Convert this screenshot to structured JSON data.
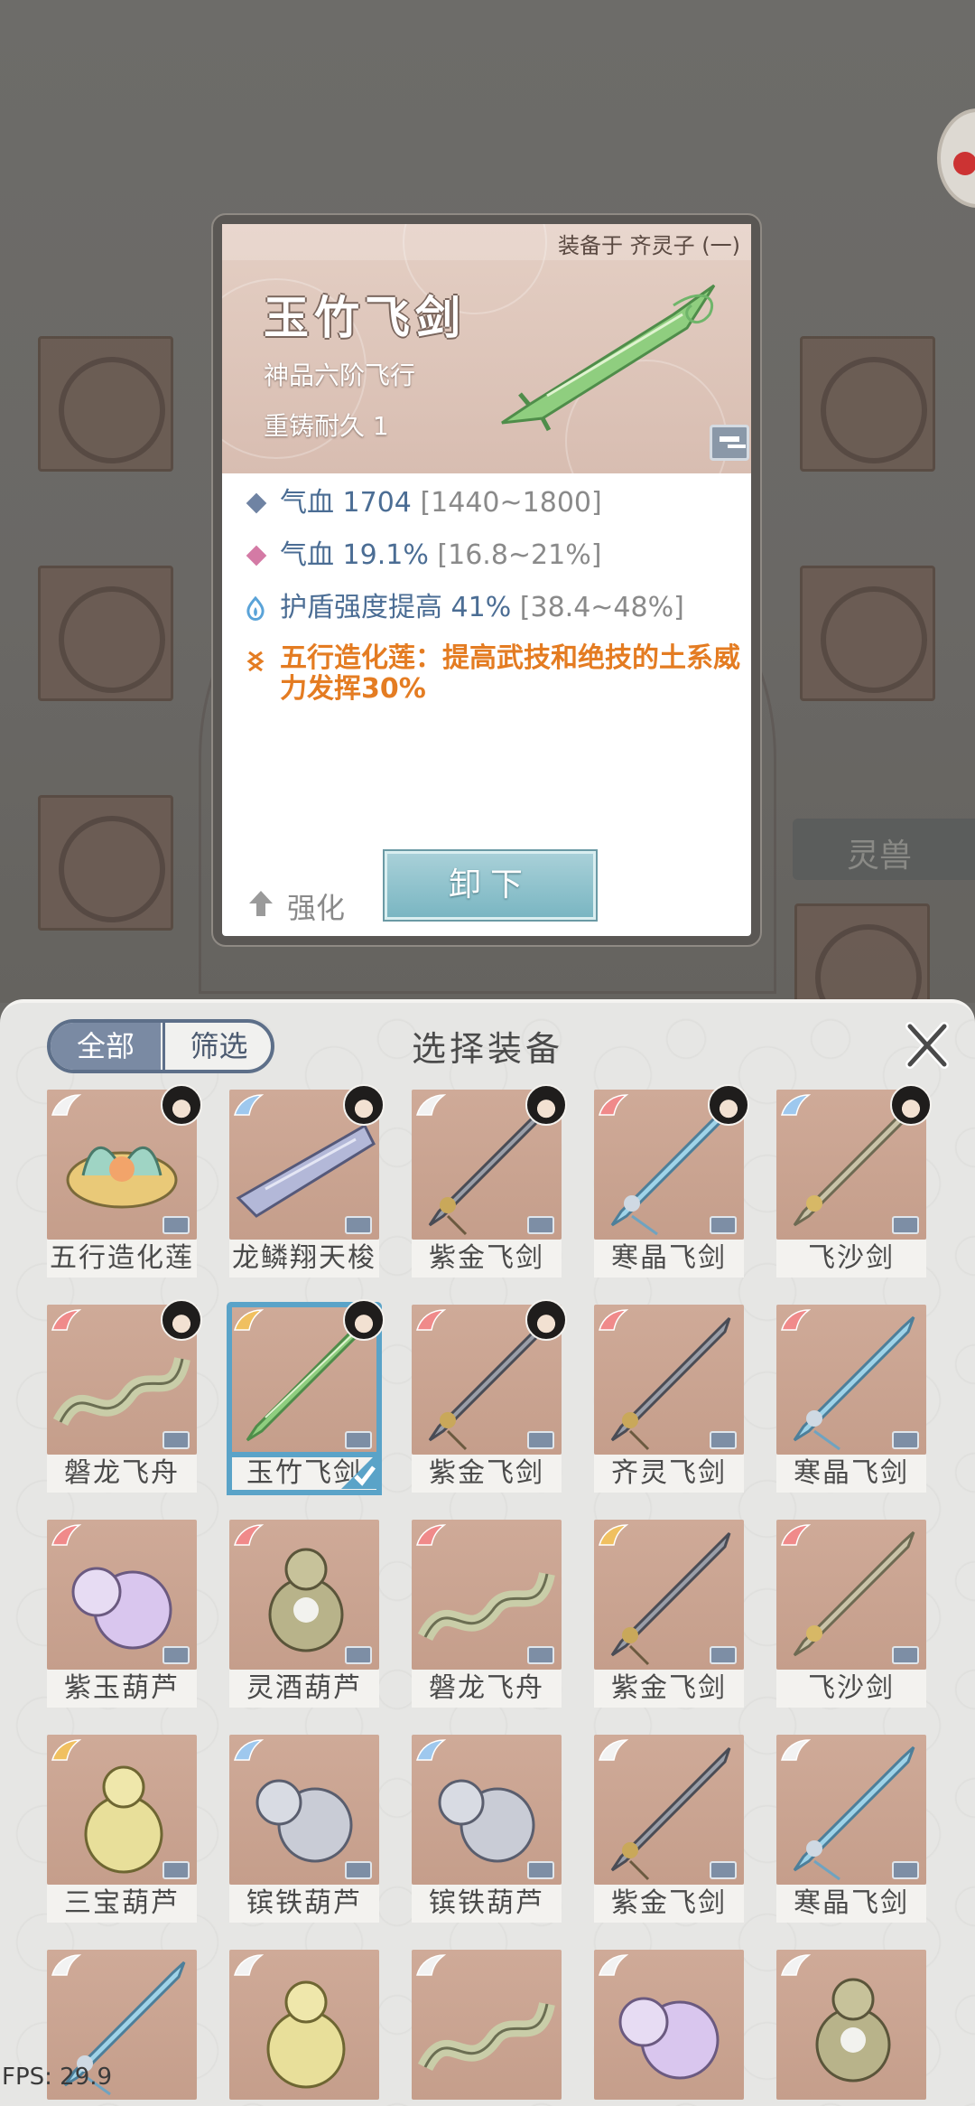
{
  "background": {
    "beast_tab_label": "灵兽"
  },
  "detail_card": {
    "equipped_on": "装备于 齐灵子 (一)",
    "title": "玉竹飞剑",
    "grade": "神品六阶飞行",
    "recast_durability": "重铸耐久 1",
    "stats": [
      {
        "icon": "blue-diamond-icon",
        "name": "气血",
        "value": "1704",
        "range": "[1440~1800]"
      },
      {
        "icon": "pink-diamond-icon",
        "name": "气血",
        "value": "19.1%",
        "range": "[16.8~21%]"
      },
      {
        "icon": "shield-flame-icon",
        "name": "护盾强度提高",
        "value": "41%",
        "range": "[38.4~48%]"
      }
    ],
    "special_effect": "五行造化莲：提高武技和绝技的土系威力发挥30%",
    "enhance_label": "强化",
    "unequip_label": "卸下"
  },
  "panel": {
    "tab_all": "全部",
    "tab_filter": "筛选",
    "title": "选择装备",
    "close_label": "X"
  },
  "items": [
    {
      "name": "五行造化莲",
      "wing": "#f2f2f2",
      "has_avatar": true,
      "kind": "lotus"
    },
    {
      "name": "龙鳞翔天梭",
      "wing": "#9ec8ee",
      "has_avatar": true,
      "kind": "boat"
    },
    {
      "name": "紫金飞剑",
      "wing": "#f2f2f2",
      "has_avatar": true,
      "kind": "sword-dark"
    },
    {
      "name": "寒晶飞剑",
      "wing": "#f08a8a",
      "has_avatar": true,
      "kind": "sword-ice"
    },
    {
      "name": "飞沙剑",
      "wing": "#9ec8ee",
      "has_avatar": true,
      "kind": "sword-gold"
    },
    {
      "name": "磐龙飞舟",
      "wing": "#f08a8a",
      "has_avatar": true,
      "kind": "dragon"
    },
    {
      "name": "玉竹飞剑",
      "wing": "#f0c060",
      "has_avatar": true,
      "kind": "sword-jade",
      "selected": true
    },
    {
      "name": "紫金飞剑",
      "wing": "#f08a8a",
      "has_avatar": true,
      "kind": "sword-dark"
    },
    {
      "name": "齐灵飞剑",
      "wing": "#f08a8a",
      "has_avatar": false,
      "kind": "sword-dark"
    },
    {
      "name": "寒晶飞剑",
      "wing": "#f08a8a",
      "has_avatar": false,
      "kind": "sword-ice"
    },
    {
      "name": "紫玉葫芦",
      "wing": "#f08a8a",
      "has_avatar": false,
      "kind": "gourd-purple"
    },
    {
      "name": "灵酒葫芦",
      "wing": "#f08a8a",
      "has_avatar": false,
      "kind": "gourd-green"
    },
    {
      "name": "磐龙飞舟",
      "wing": "#f08a8a",
      "has_avatar": false,
      "kind": "dragon"
    },
    {
      "name": "紫金飞剑",
      "wing": "#f0c060",
      "has_avatar": false,
      "kind": "sword-dark"
    },
    {
      "name": "飞沙剑",
      "wing": "#f08a8a",
      "has_avatar": false,
      "kind": "sword-gold"
    },
    {
      "name": "三宝葫芦",
      "wing": "#f0c060",
      "has_avatar": false,
      "kind": "gourd-gold"
    },
    {
      "name": "镔铁葫芦",
      "wing": "#9ec8ee",
      "has_avatar": false,
      "kind": "gourd-iron"
    },
    {
      "name": "镔铁葫芦",
      "wing": "#9ec8ee",
      "has_avatar": false,
      "kind": "gourd-iron"
    },
    {
      "name": "紫金飞剑",
      "wing": "#f2f2f2",
      "has_avatar": false,
      "kind": "sword-dark"
    },
    {
      "name": "寒晶飞剑",
      "wing": "#f2f2f2",
      "has_avatar": false,
      "kind": "sword-ice"
    },
    {
      "name": "",
      "wing": "#f2f2f2",
      "has_avatar": false,
      "kind": "sword-ice",
      "partial": true
    },
    {
      "name": "",
      "wing": "#f2f2f2",
      "has_avatar": false,
      "kind": "gourd-gold",
      "partial": true
    },
    {
      "name": "",
      "wing": "#f2f2f2",
      "has_avatar": false,
      "kind": "dragon",
      "partial": true
    },
    {
      "name": "",
      "wing": "#f2f2f2",
      "has_avatar": false,
      "kind": "gourd-purple",
      "partial": true
    },
    {
      "name": "",
      "wing": "#f2f2f2",
      "has_avatar": false,
      "kind": "gourd-green",
      "partial": true
    }
  ],
  "fps": "FPS: 29.9"
}
